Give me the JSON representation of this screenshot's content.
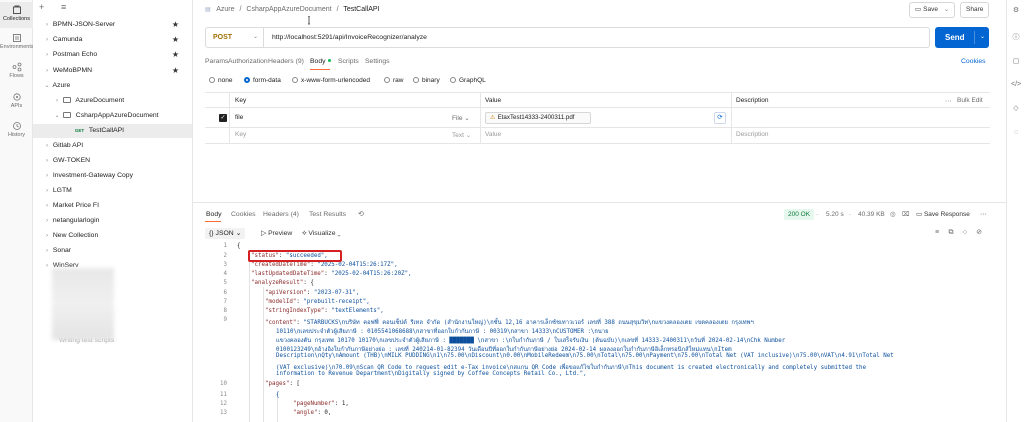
{
  "rail": {
    "items": [
      {
        "label": "Collections",
        "icon": "collections-icon"
      },
      {
        "label": "Environments",
        "icon": "environments-icon"
      },
      {
        "label": "Flows",
        "icon": "flows-icon"
      },
      {
        "label": "APIs",
        "icon": "apis-icon"
      },
      {
        "label": "History",
        "icon": "history-icon"
      }
    ]
  },
  "sidebar": {
    "items": [
      {
        "label": "BPMN-JSON-Server",
        "starred": true
      },
      {
        "label": "Camunda",
        "starred": true
      },
      {
        "label": "Postman Echo",
        "starred": true
      },
      {
        "label": "WeMoBPMN",
        "starred": true
      },
      {
        "label": "Azure",
        "starred": false
      },
      {
        "label": "AzureDocument",
        "starred": false
      },
      {
        "label": "CsharpAppAzureDocument",
        "starred": false
      },
      {
        "label": "TestCallAPI",
        "method": "GET",
        "starred": false
      },
      {
        "label": "Gitlab API",
        "starred": false
      },
      {
        "label": "GW-TOKEN",
        "starred": false
      },
      {
        "label": "Investment-Gateway Copy",
        "starred": false
      },
      {
        "label": "LGTM",
        "starred": false
      },
      {
        "label": "Market Price FI",
        "starred": false
      },
      {
        "label": "netangularlogin",
        "starred": false
      },
      {
        "label": "New Collection",
        "starred": false
      },
      {
        "label": "Sonar",
        "starred": false
      },
      {
        "label": "WinServ",
        "starred": false
      },
      {
        "label": "Writing test scripts",
        "starred": false
      }
    ]
  },
  "header": {
    "crumb1": "Azure",
    "sep": "/",
    "crumb2": "CsharpAppAzureDocument",
    "current": "TestCallAPI",
    "save_label": "Save",
    "share_label": "Share"
  },
  "request": {
    "method": "POST",
    "url": "http://localhost:5291/api/InvoiceRecognizer/analyze",
    "send_label": "Send",
    "cookies_label": "Cookies"
  },
  "tabs": {
    "params": "Params",
    "authorization": "Authorization",
    "headers": "Headers (9)",
    "body": "Body",
    "scripts": "Scripts",
    "settings": "Settings"
  },
  "body_modes": [
    "none",
    "form-data",
    "x-www-form-urlencoded",
    "raw",
    "binary",
    "GraphQL"
  ],
  "form_table": {
    "col_key": "Key",
    "col_value": "Value",
    "col_description": "Description",
    "bulk_edit": "Bulk Edit",
    "row_key": "file",
    "row_type": "File",
    "row_value": "EtaxTest14333-2400311.pdf",
    "empty_key": "Key",
    "empty_type": "Text",
    "empty_value": "Value",
    "empty_description": "Description"
  },
  "response": {
    "tabs": [
      "Body",
      "Cookies",
      "Headers (4)",
      "Test Results"
    ],
    "status": "200 OK",
    "time": "5.20 s",
    "size": "40.39 KB",
    "save_response": "Save Response",
    "format": "JSON",
    "preview": "Preview",
    "visualize": "Visualize"
  },
  "code_lines": [
    {
      "n": "1",
      "text": "{"
    },
    {
      "n": "2",
      "text": "\"status\": \"succeeded\","
    },
    {
      "n": "3",
      "text": "\"createdDateTime\": \"2025-02-04T15:26:17Z\","
    },
    {
      "n": "4",
      "text": "\"lastUpdatedDateTime\": \"2025-02-04T15:26:20Z\","
    },
    {
      "n": "5",
      "text": "\"analyzeResult\": {"
    },
    {
      "n": "6",
      "text": "\"apiVersion\": \"2023-07-31\","
    },
    {
      "n": "7",
      "text": "\"modelId\": \"prebuilt-receipt\","
    },
    {
      "n": "8",
      "text": "\"stringIndexType\": \"textElements\","
    },
    {
      "n": "9",
      "text": "\"content\": \"STARBUCKS\\nบริษัท คอฟฟี่ คอนเซ็ปต์ รีเทล จำกัด (สำนักงานใหญ่)\\nชั้น 12,16 อาคารเล็กซ์ชเทาวเวอร์ เลขที่ 388 ถนนสุขุมวิท\\nแขวงคลองเตย เขตคลองเตย กรุงเทพฯ"
    },
    {
      "n": "",
      "text": "10110\\nเลขประจำตัวผู้เสียภาษี : 0105541068688\\nสาขาที่ออกใบกำกับภาษี : 00319\\nสาขา 14333\\nCUSTOMER :\\nนาย"
    },
    {
      "n": "",
      "text": "แขวงคลองตัน กรุงเทพ 10170 10170\\nเลขประจำตัวผู้เสียภาษี : ███████ \\nสาขา :\\nใบกำกับภาษี / ใบเสร็จรับเงิน (ต้นฉบับ)\\nเลขที่ 14333-2400311\\nวันที่ 2024-02-14\\nChk Number"
    },
    {
      "n": "",
      "text": "0100123249\\nอ้างอิงใบกำกับภาษีอย่างย่อ : เลขที่ 240214-01-82394 วันเดือนปีที่ออกใบกำกับภาษีอย่างย่อ 2024-02-14 ผลลงออกใบกำกับภาษีอิเล็กทรอนิกส์ใหม่แทน\\nItem"
    },
    {
      "n": "",
      "text": "Description\\nQty\\nAmount (THB)\\nMILK PUDDING\\n1\\n75.00\\nDiscount\\n0.00\\nMobileRedeem\\n75.00\\nTotal\\n75.00\\nPayment\\n75.00\\nTotal Net (VAT inclusive)\\n75.00\\nVAT\\n4.91\\nTotal Net"
    },
    {
      "n": "",
      "text": "(VAT exclusive)\\n70.09\\nScan QR Code to request edit e-Tax invoice\\nสแกน QR Code เพื่อขอแก้ไขใบกำกับภาษี\\nThis document is created electronically and completely submitted the"
    },
    {
      "n": "",
      "text": "information to Revenue Department\\nDigitally signed by Coffee Concepts Retail Co., Ltd.\","
    },
    {
      "n": "10",
      "text": "\"pages\": ["
    },
    {
      "n": "11",
      "text": "{"
    },
    {
      "n": "12",
      "text": "\"pageNumber\": 1,"
    },
    {
      "n": "13",
      "text": "\"angle\": 0,"
    }
  ]
}
